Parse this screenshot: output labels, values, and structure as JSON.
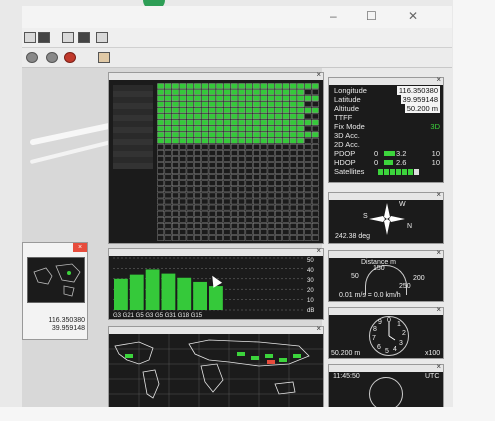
{
  "title_bar": {
    "minimize": "–",
    "maximize": "☐",
    "close": "✕"
  },
  "toolbar_icons": [
    "save-icon",
    "open-icon",
    "print-icon",
    "settings-icon",
    "connect-icon"
  ],
  "info_panel": {
    "longitude_label": "Longitude",
    "longitude_value": "116.350380",
    "latitude_label": "Latitude",
    "latitude_value": "39.959148",
    "altitude_label": "Altitude",
    "altitude_value": "50.200 m",
    "ttff_label": "TTFF",
    "fix_mode_label": "Fix Mode",
    "fix_mode_value": "3D",
    "acc3d_label": "3D Acc.",
    "acc2d_label": "2D Acc.",
    "pdop_label": "PDOP",
    "pdop_min": "0",
    "pdop_value": "3.2",
    "pdop_max": "10",
    "hdop_label": "HDOP",
    "hdop_min": "0",
    "hdop_value": "2.6",
    "hdop_max": "10",
    "satellites_label": "Satellites",
    "pdop_level": 0.32,
    "hdop_level": 0.26
  },
  "compass_panel": {
    "n": "N",
    "s": "S",
    "w": "W",
    "heading": "242.38 deg"
  },
  "speed_panel": {
    "title": "Distance m",
    "tick_50": "50",
    "tick_150": "150",
    "tick_200": "200",
    "tick_250": "250",
    "speed": "0.01 m/s = 0.0 km/h"
  },
  "altimeter_panel": {
    "t0": "0",
    "t1": "1",
    "t2": "2",
    "t3": "3",
    "t4": "4",
    "t5": "5",
    "t6": "6",
    "t7": "7",
    "t8": "8",
    "t9": "9",
    "value": "50.200 m",
    "multiplier": "x100"
  },
  "clock_panel": {
    "time": "11:45:50",
    "zone": "UTC"
  },
  "snr_panel": {
    "bar_labels": "G3 G21 G5 G3 G5 G31 G18 G15",
    "y_ticks": [
      "50",
      "40",
      "30",
      "20",
      "10",
      "dB"
    ]
  },
  "side_window": {
    "longitude": "116.350380",
    "latitude": "39.959148",
    "close": "×"
  },
  "chart_data": {
    "type": "bar",
    "categories": [
      "G3",
      "G21",
      "G5",
      "G3",
      "G5",
      "G31",
      "G18",
      "G15"
    ],
    "values": [
      30,
      34,
      39,
      35,
      31,
      27,
      23,
      0
    ],
    "ylim": [
      0,
      50
    ],
    "ylabel": "dB"
  }
}
